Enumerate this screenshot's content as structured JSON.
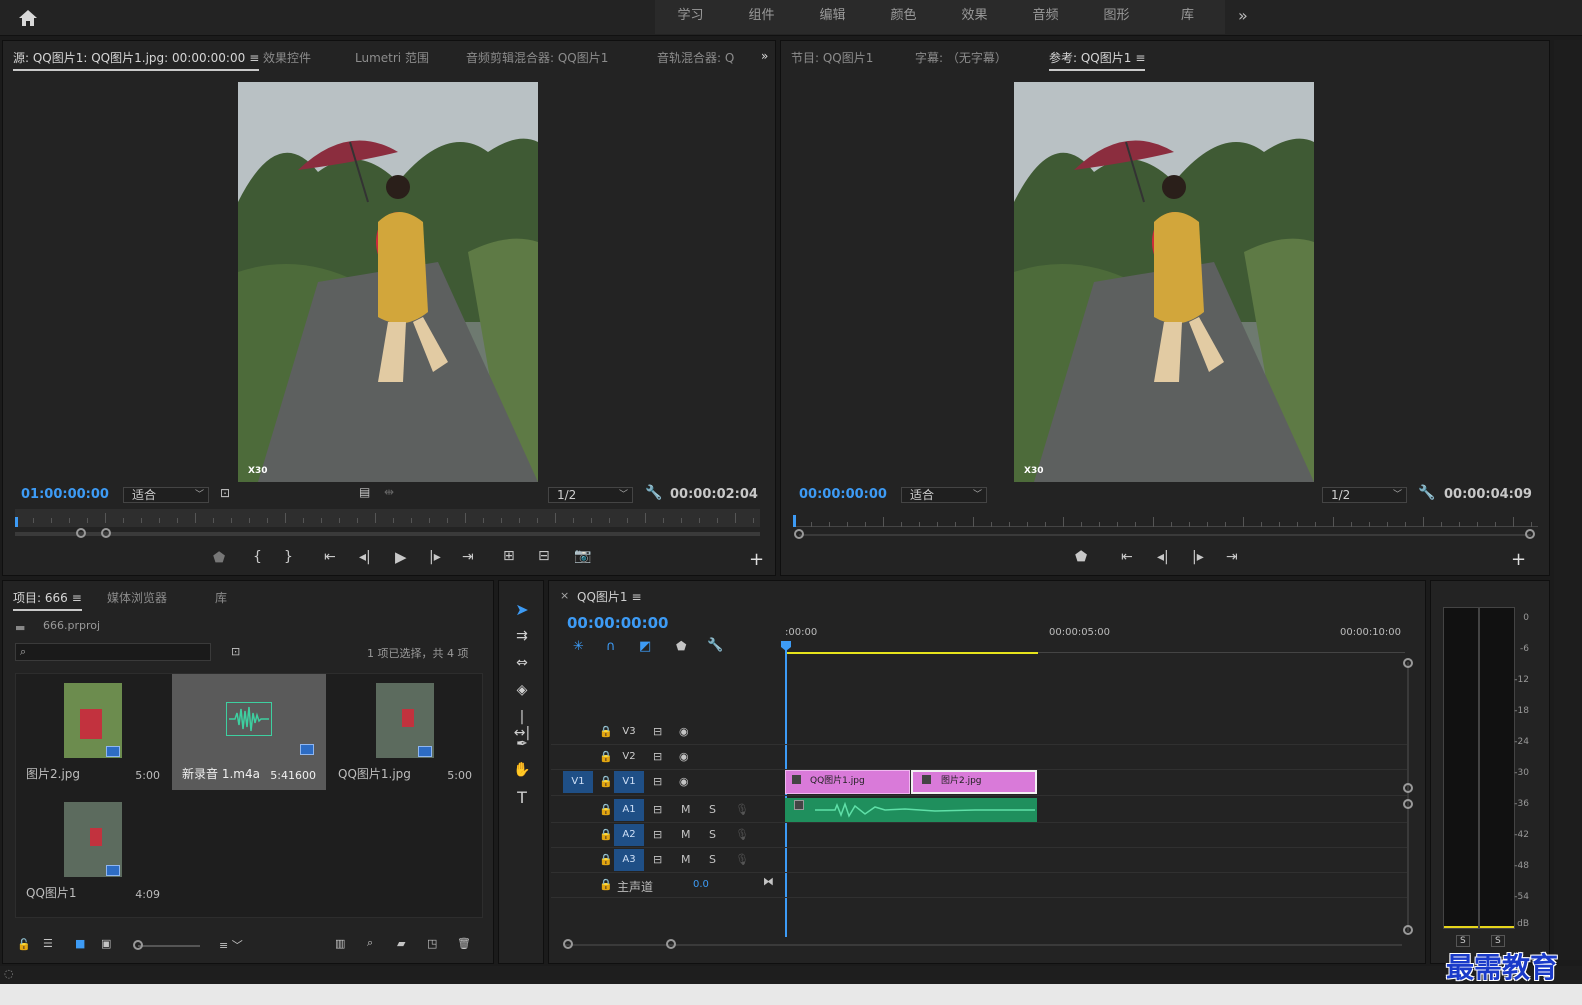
{
  "menubar": {
    "workspaces": [
      "学习",
      "组件",
      "编辑",
      "颜色",
      "效果",
      "音频",
      "图形",
      "库"
    ],
    "more": "»"
  },
  "source_panel": {
    "tabs": [
      "源: QQ图片1: QQ图片1.jpg: 00:00:00:00",
      "效果控件",
      "Lumetri 范围",
      "音频剪辑混合器: QQ图片1",
      "音轨混合器: Q"
    ],
    "more": "»",
    "timecode": "01:00:00:00",
    "zoom": "适合",
    "resolution": "1/2",
    "duration": "00:00:02:04",
    "watermark_text": "X30"
  },
  "program_panel": {
    "tabs": [
      "节目: QQ图片1",
      "字幕: （无字幕）",
      "参考: QQ图片1"
    ],
    "timecode": "00:00:00:00",
    "zoom": "适合",
    "resolution": "1/2",
    "duration": "00:00:04:09",
    "watermark_text": "X30"
  },
  "project_panel": {
    "tabs": [
      "项目: 666",
      "媒体浏览器",
      "库"
    ],
    "project_file": "666.prproj",
    "search_placeholder": "",
    "selection_info": "1 项已选择，共 4 项",
    "items": [
      {
        "name": "图片2.jpg",
        "duration": "5:00"
      },
      {
        "name": "新录音 1.m4a",
        "duration": "5:41600"
      },
      {
        "name": "QQ图片1.jpg",
        "duration": "5:00"
      },
      {
        "name": "QQ图片1",
        "duration": "4:09"
      }
    ]
  },
  "timeline": {
    "tab": "QQ图片1",
    "close": "×",
    "timecode": "00:00:00:00",
    "ruler": [
      ":00:00",
      "00:00:05:00",
      "00:00:10:00"
    ],
    "video_tracks": [
      "V3",
      "V2",
      "V1"
    ],
    "audio_tracks": [
      "A1",
      "A2",
      "A3"
    ],
    "source_patch_v": "V1",
    "mute": "M",
    "solo": "S",
    "master": "主声道",
    "master_value": "0.0",
    "clips": [
      "QQ图片1.jpg",
      "图片2.jpg"
    ]
  },
  "meter": {
    "labels": [
      "0",
      "-6",
      "-12",
      "-18",
      "-24",
      "-30",
      "-36",
      "-42",
      "-48",
      "-54",
      "dB"
    ],
    "solo": [
      "S",
      "S"
    ]
  },
  "watermark": "最需教育"
}
